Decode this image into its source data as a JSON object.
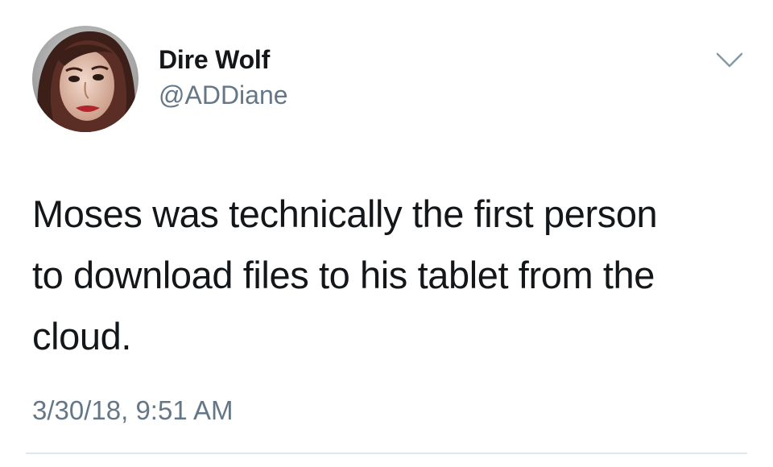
{
  "tweet": {
    "author": {
      "display_name": "Dire Wolf",
      "handle": "@ADDiane",
      "avatar_icon": "profile-photo"
    },
    "menu_icon": "chevron-down-icon",
    "text": "Moses was technically the first person\nto download files to his tablet from the\ncloud.",
    "timestamp": "3/30/18, 9:51 AM"
  },
  "colors": {
    "text_primary": "#14171a",
    "text_secondary": "#657786",
    "divider": "#e1e8ed",
    "caret": "#8899a6"
  }
}
